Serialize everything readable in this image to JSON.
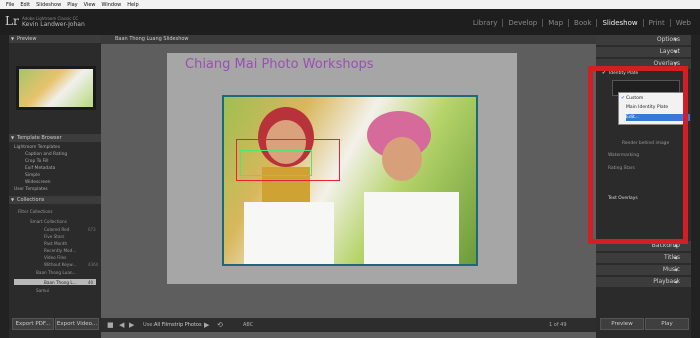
{
  "menu": [
    "File",
    "Edit",
    "Slideshow",
    "Play",
    "View",
    "Window",
    "Help"
  ],
  "identity": {
    "logo": "Lr",
    "subtitle": "Adobe Lightroom Classic CC",
    "user": "Kevin Landwer-Johan"
  },
  "modules": [
    "Library",
    "Develop",
    "Map",
    "Book",
    "Slideshow",
    "Print",
    "Web"
  ],
  "left_panel": {
    "preview_header": "Preview",
    "template_header": "Template Browser",
    "templates": [
      "Lightroom Templates",
      "Caption and Rating",
      "Crop To Fill",
      "Exif Metadata",
      "Simple",
      "Widescreen",
      "User Templates"
    ],
    "collections_header": "Collections",
    "collections": [
      "Filter Collections",
      "Smart Collections",
      "Colored Red",
      "Five Stars",
      "Past Month",
      "Recently Mod...",
      "Video Files",
      "Without Keyw...",
      "Baan Thong Luan...",
      "Baan Thong L...",
      "Samui"
    ],
    "counts": [
      "",
      "",
      "673",
      "",
      "",
      "",
      "",
      "4364",
      "",
      "40",
      ""
    ],
    "export_pdf": "Export PDF...",
    "export_video": "Export Video..."
  },
  "center": {
    "title": "Baan Thong Luang Slideshow",
    "identity_plate_text": "Chiang Mai Photo Workshops",
    "use_label": "Use:",
    "use_value": "All Filmstrip Photos",
    "abc": "ABC",
    "slide_info": "1 of 49"
  },
  "right_panel": {
    "headers": [
      "Options",
      "Layout",
      "Overlays",
      "Backdrop",
      "Titles",
      "Music",
      "Playback"
    ],
    "identity_plate_label": "Identity Plate",
    "popup": [
      "Custom",
      "Main Identity Plate",
      "Edit..."
    ],
    "items": [
      "Render behind image",
      "Watermarking",
      "Rating Stars",
      "Text Overlays"
    ],
    "preview_btn": "Preview",
    "play_btn": "Play"
  },
  "colors": {
    "highlight": "#d21f26",
    "identity_text": "#9a4fb3"
  }
}
